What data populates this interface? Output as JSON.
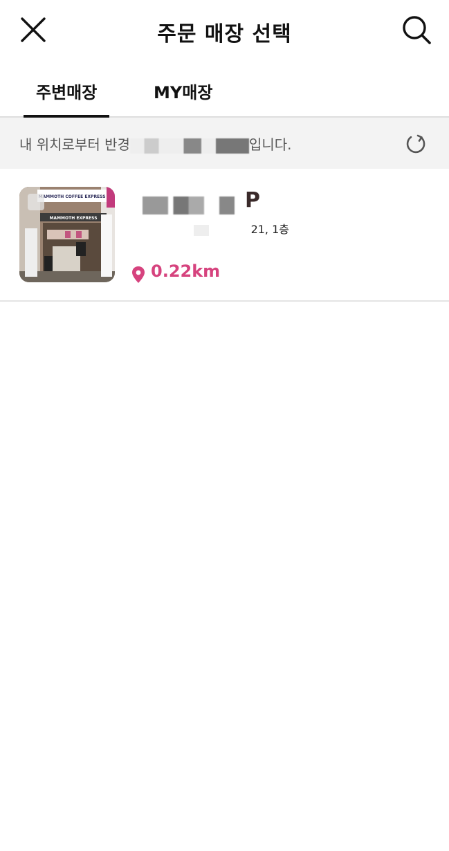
{
  "header": {
    "title": "주문 매장 선택",
    "close_icon": "close-icon",
    "search_icon": "search-icon"
  },
  "tabs": [
    {
      "label": "주변매장",
      "active": true
    },
    {
      "label": "MY매장",
      "active": false
    }
  ],
  "location_bar": {
    "text_start": "내 위치로부터 반경",
    "text_end": "입니다.",
    "refresh_icon": "refresh-icon"
  },
  "stores": [
    {
      "name_visible_tail": "P",
      "address_tail": "21, 1층",
      "distance": "0.22km",
      "photo_signs": [
        "MAMMOTH COFFEE EXPRESS",
        "MAMMOTH EXPRESS"
      ],
      "pin_icon": "location-pin-icon"
    }
  ],
  "colors": {
    "accent": "#d6437e",
    "text": "#111111",
    "location_bar_bg": "#f3f3f3"
  }
}
